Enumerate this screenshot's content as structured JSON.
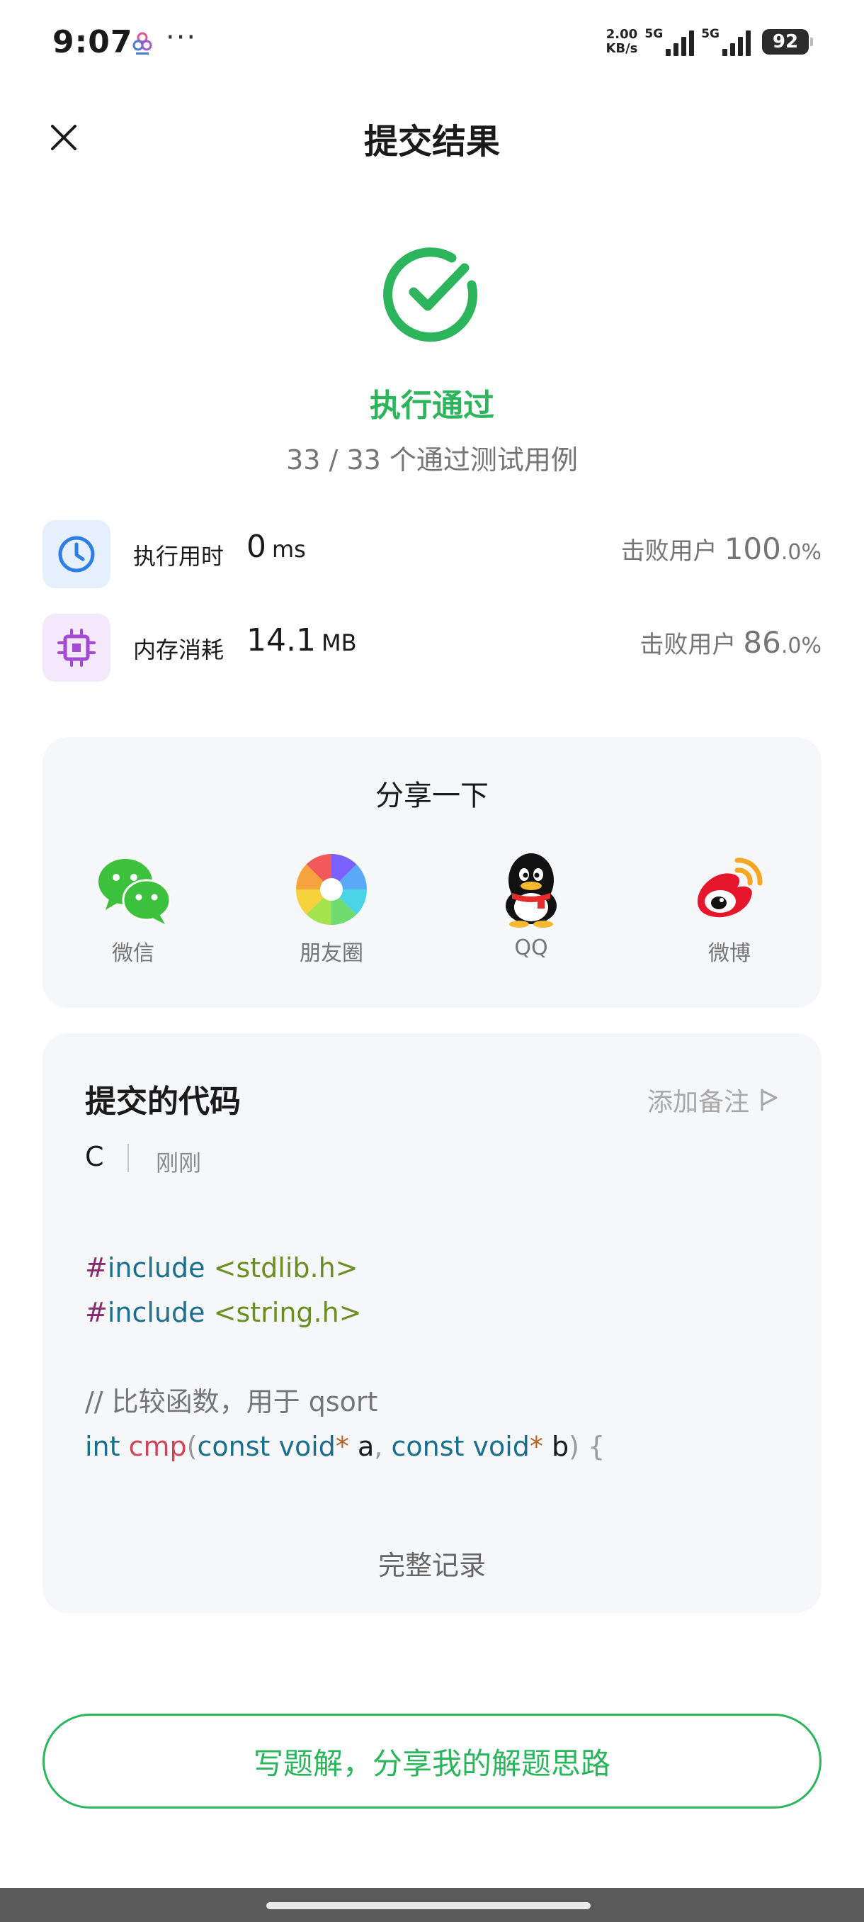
{
  "status_bar": {
    "time": "9:07",
    "more": "···",
    "net_speed_value": "2.00",
    "net_speed_unit": "KB/s",
    "net1": "5G",
    "net2": "5G",
    "battery": "92"
  },
  "header": {
    "title": "提交结果",
    "close_icon": "close-icon"
  },
  "result": {
    "status": "执行通过",
    "cases": "33 / 33 个通过测试用例",
    "accent_color": "#2db55d"
  },
  "stats": {
    "runtime": {
      "label": "执行用时",
      "value": "0",
      "unit": "ms",
      "beat_label": "击败用户",
      "beat_int": "100",
      "beat_dec": ".0%",
      "icon": "clock-icon"
    },
    "memory": {
      "label": "内存消耗",
      "value": "14.1",
      "unit": "MB",
      "beat_label": "击败用户",
      "beat_int": "86",
      "beat_dec": ".0%",
      "icon": "chip-icon"
    }
  },
  "share": {
    "title": "分享一下",
    "items": [
      {
        "label": "微信",
        "icon": "wechat-icon"
      },
      {
        "label": "朋友圈",
        "icon": "moments-icon"
      },
      {
        "label": "QQ",
        "icon": "qq-icon"
      },
      {
        "label": "微博",
        "icon": "weibo-icon"
      }
    ]
  },
  "code": {
    "title": "提交的代码",
    "add_note": "添加备注",
    "language": "C",
    "time": "刚刚",
    "lines": [
      {
        "directive": "#",
        "keyword": "include",
        "header": "<stdlib.h>"
      },
      {
        "directive": "#",
        "keyword": "include",
        "header": "<string.h>"
      },
      {
        "comment": "// 比较函数，用于 qsort"
      },
      {
        "t1": "int",
        "t2": "cmp",
        "t3": "(",
        "t4": "const void",
        "t5": "*",
        "t6": " a",
        "t7": ", ",
        "t8": "const void",
        "t9": "*",
        "t10": " b",
        "t11": ") {"
      }
    ],
    "full_record": "完整记录"
  },
  "write_solution_button": "写题解，分享我的解题思路"
}
